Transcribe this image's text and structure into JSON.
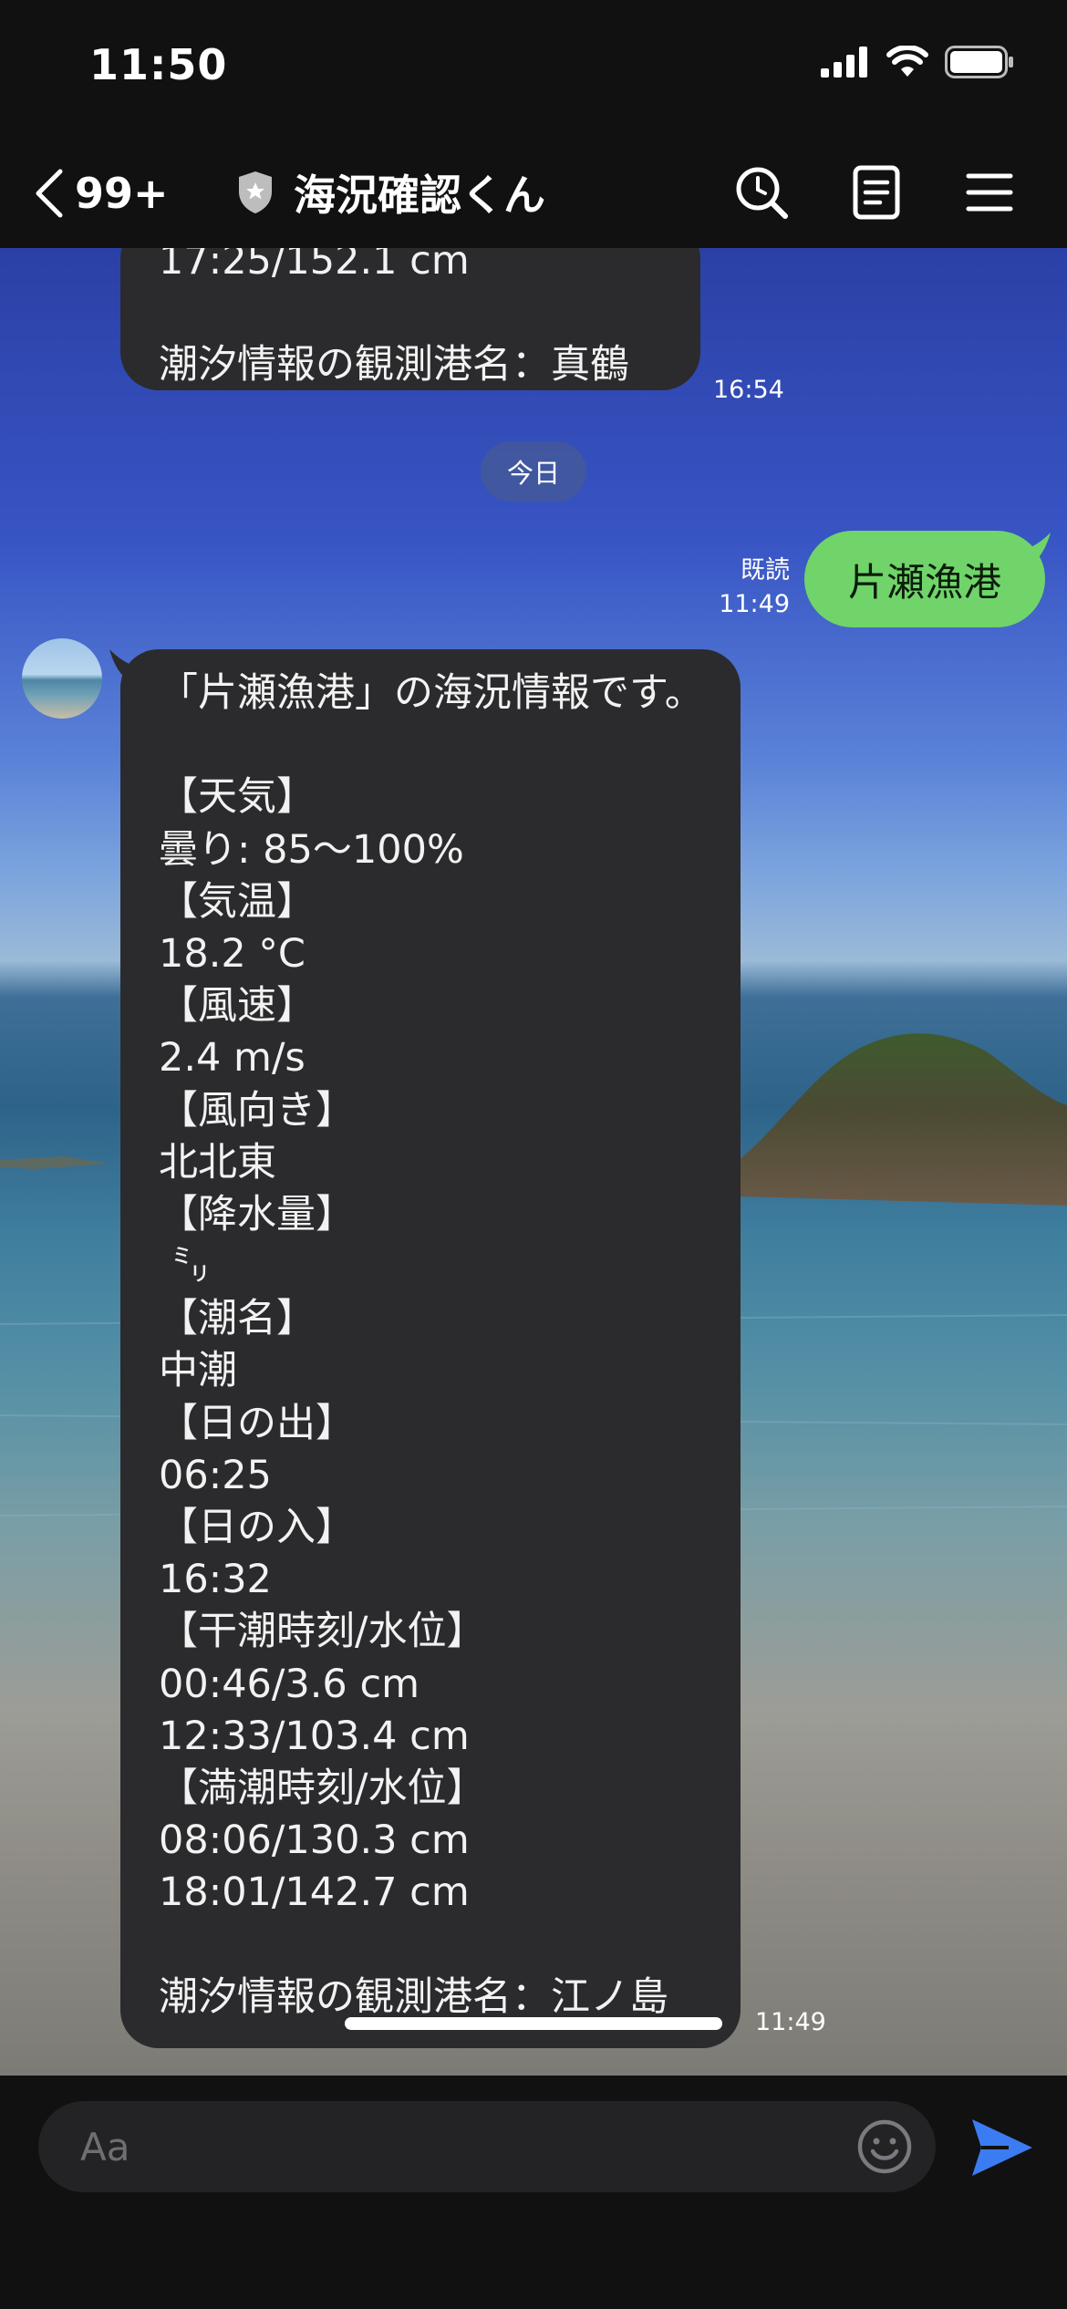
{
  "status_bar": {
    "time": "11:50"
  },
  "header": {
    "back_count": "99+",
    "title": "海況確認くん"
  },
  "previous_message": {
    "lines": [
      "17:25/152.1 cm",
      "",
      "潮汐情報の観測港名：真鶴"
    ],
    "time": "16:54"
  },
  "date_divider": "今日",
  "sent_message": {
    "text": "片瀬漁港",
    "read_label": "既読",
    "time": "11:49"
  },
  "received_message": {
    "lines": [
      "「片瀬漁港」の海況情報です。",
      "",
      "【天気】",
      "曇り: 85～100%",
      "【気温】",
      "18.2 °C",
      "【風速】",
      "2.4 m/s",
      "【風向き】",
      "北北東",
      "【降水量】",
      " ㍉",
      "【潮名】",
      "中潮",
      "【日の出】",
      "06:25",
      "【日の入】",
      "16:32",
      "【干潮時刻/水位】",
      "00:46/3.6 cm",
      "12:33/103.4 cm",
      "【満潮時刻/水位】",
      "08:06/130.3 cm",
      "18:01/142.7 cm",
      "",
      "潮汐情報の観測港名：江ノ島"
    ],
    "time": "11:49"
  },
  "input": {
    "placeholder": "Aa"
  },
  "icons": {
    "back": "chevron-left-icon",
    "shield": "shield-star-icon",
    "search": "search-icon",
    "notes": "notes-icon",
    "menu": "menu-icon",
    "emoji": "emoji-icon",
    "send": "send-icon"
  },
  "colors": {
    "sent_bubble": "#70d46a",
    "received_bubble": "#2b2b2d",
    "send_icon": "#3c7cf2"
  }
}
